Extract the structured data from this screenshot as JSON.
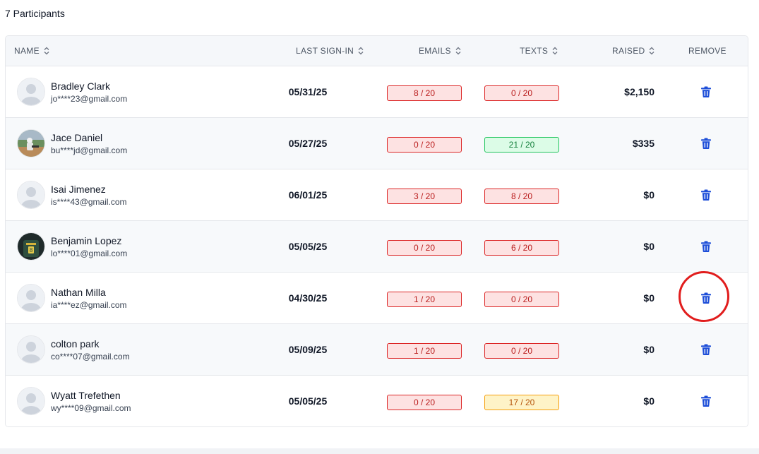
{
  "participant_count": "7 Participants",
  "headers": {
    "name": "NAME",
    "last_sign_in": "LAST SIGN-IN",
    "emails": "EMAILS",
    "texts": "TEXTS",
    "raised": "RAISED",
    "remove": "REMOVE"
  },
  "participants": [
    {
      "name": "Bradley Clark",
      "email": "jo****23@gmail.com",
      "last_sign_in": "05/31/25",
      "emails": "8 / 20",
      "texts": "0 / 20",
      "raised": "$2,150",
      "avatar": "default-avatar"
    },
    {
      "name": "Jace Daniel",
      "email": "bu****jd@gmail.com",
      "last_sign_in": "05/27/25",
      "emails": "0 / 20",
      "texts": "21 / 20",
      "raised": "$335",
      "avatar": "photo-avatar"
    },
    {
      "name": "Isai Jimenez",
      "email": "is****43@gmail.com",
      "last_sign_in": "06/01/25",
      "emails": "3 / 20",
      "texts": "8 / 20",
      "raised": "$0",
      "avatar": "default-avatar"
    },
    {
      "name": "Benjamin Lopez",
      "email": "lo****01@gmail.com",
      "last_sign_in": "05/05/25",
      "emails": "0 / 20",
      "texts": "6 / 20",
      "raised": "$0",
      "avatar": "photo-avatar"
    },
    {
      "name": "Nathan Milla",
      "email": "ia****ez@gmail.com",
      "last_sign_in": "04/30/25",
      "emails": "1 / 20",
      "texts": "0 / 20",
      "raised": "$0",
      "avatar": "default-avatar"
    },
    {
      "name": "colton park",
      "email": "co****07@gmail.com",
      "last_sign_in": "05/09/25",
      "emails": "1 / 20",
      "texts": "0 / 20",
      "raised": "$0",
      "avatar": "default-avatar"
    },
    {
      "name": "Wyatt Trefethen",
      "email": "wy****09@gmail.com",
      "last_sign_in": "05/05/25",
      "emails": "0 / 20",
      "texts": "17 / 20",
      "raised": "$0",
      "avatar": "default-avatar"
    }
  ],
  "colors": {
    "badge_red": "#dc2626",
    "badge_green": "#22c55e",
    "badge_yellow": "#f59e0b",
    "trash_icon": "#1d4ed8",
    "highlight": "#e11d1d"
  },
  "icons": {
    "sort": "sort-icon",
    "remove": "trash-icon"
  }
}
